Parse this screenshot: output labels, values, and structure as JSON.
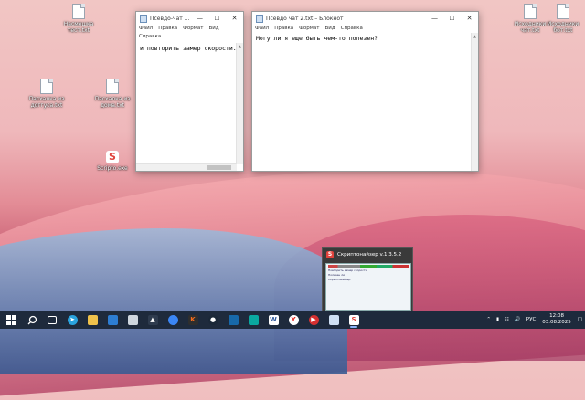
{
  "desktop_icons": [
    {
      "label": "Насмешка\nтест.txt"
    },
    {
      "label": "Пасхалка из\nдоггуса.txt"
    },
    {
      "label": "Пасхалка из\nдома.txt"
    },
    {
      "label": "Scripto.exe"
    },
    {
      "label": "Исходники\nчат.txt"
    },
    {
      "label": "Исходники\nбот.txt"
    }
  ],
  "notepad1": {
    "title": "Псевдо-чат ...",
    "menu": [
      "Файл",
      "Правка",
      "Формат",
      "Вид",
      "Справка"
    ],
    "content": "и повторить замер скорости."
  },
  "notepad2": {
    "title": "Псевдо чат 2.txt – Блокнот",
    "menu": [
      "Файл",
      "Правка",
      "Формат",
      "Вид",
      "Справка"
    ],
    "content": "Могу ли я еще быть чем-то полезен?"
  },
  "taskbar_preview": {
    "title": "Скриптонайзер v.1.3.5.2",
    "lines": [
      "Повторить замер скорости",
      "Полезен ли",
      "Скриптонайзер"
    ]
  },
  "tray": {
    "lang": "РУС",
    "time": "12:08",
    "date": "03.08.2025"
  },
  "colors": {
    "taskbar": "#1e2a3c",
    "accent": "#8ab4f8",
    "app_red": "#e0433c"
  }
}
